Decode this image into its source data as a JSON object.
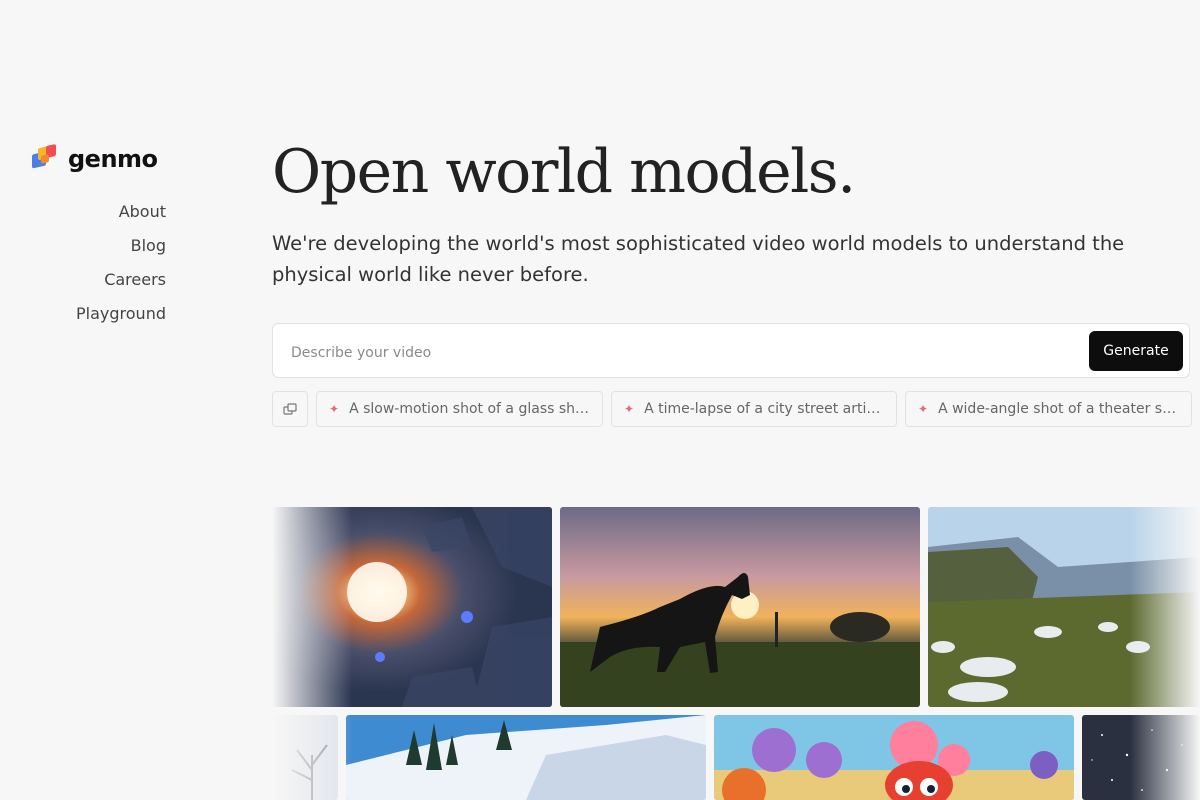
{
  "brand": {
    "name": "genmo"
  },
  "nav": {
    "items": [
      {
        "label": "About"
      },
      {
        "label": "Blog"
      },
      {
        "label": "Careers"
      },
      {
        "label": "Playground"
      }
    ]
  },
  "hero": {
    "title": "Open world models.",
    "subtitle": "We're developing the world's most sophisticated video world models to understand the physical world like never before."
  },
  "prompt": {
    "placeholder": "Describe your video",
    "value": "",
    "generate_label": "Generate"
  },
  "suggestions": {
    "icon": "shuffle-icon",
    "items": [
      {
        "text": "A slow-motion shot of a glass shatt..."
      },
      {
        "text": "A time-lapse of a city street artist c..."
      },
      {
        "text": "A wide-angle shot of a theater stag..."
      }
    ]
  },
  "colors": {
    "background": "#f7f7f7",
    "button": "#0d0d0d",
    "spark_accent": "#e46a7a"
  }
}
